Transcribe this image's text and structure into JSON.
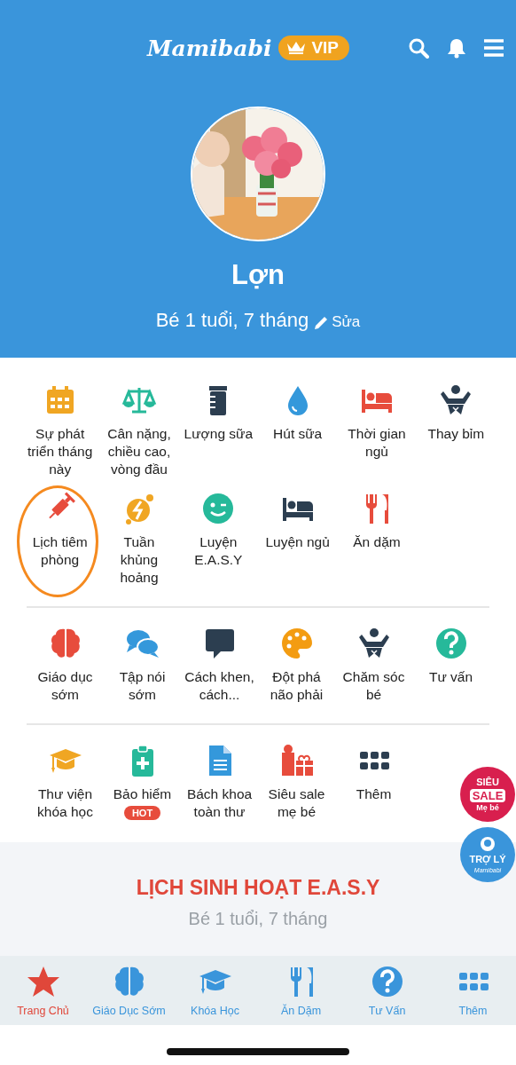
{
  "header": {
    "logo": "Mamibabi",
    "badge": "VIP"
  },
  "profile": {
    "name": "Lợn",
    "age": "Bé 1 tuổi, 7 tháng",
    "edit": "Sửa"
  },
  "menu_sections": [
    {
      "items": [
        {
          "label": "Sự phát triển tháng này",
          "circled": false
        },
        {
          "label": "Cân nặng, chiều cao, vòng đầu",
          "circled": false
        },
        {
          "label": "Lượng sữa",
          "circled": false
        },
        {
          "label": "Hút sữa",
          "circled": false
        },
        {
          "label": "Thời gian ngủ",
          "circled": false
        },
        {
          "label": "Thay bỉm",
          "circled": false
        },
        {
          "label": "Lịch tiêm phòng",
          "circled": true
        },
        {
          "label": "Tuần khủng hoảng",
          "circled": false
        },
        {
          "label": "Luyện E.A.S.Y",
          "circled": false
        },
        {
          "label": "Luyện ngủ",
          "circled": false
        },
        {
          "label": "Ăn dặm",
          "circled": false
        }
      ]
    },
    {
      "items": [
        {
          "label": "Giáo dục sớm",
          "circled": false
        },
        {
          "label": "Tập nói sớm",
          "circled": false
        },
        {
          "label": "Cách khen, cách...",
          "circled": false
        },
        {
          "label": "Đột phá não phải",
          "circled": false
        },
        {
          "label": "Chăm sóc bé",
          "circled": false
        },
        {
          "label": "Tư vấn",
          "circled": false
        }
      ]
    },
    {
      "items": [
        {
          "label": "Thư viện khóa học",
          "circled": false
        },
        {
          "label": "Bảo hiểm",
          "badge": "HOT",
          "circled": false
        },
        {
          "label": "Bách khoa toàn thư",
          "circled": false
        },
        {
          "label": "Siêu sale mẹ bé",
          "circled": false
        },
        {
          "label": "Thêm",
          "circled": false
        }
      ]
    }
  ],
  "floating_buttons": [
    {
      "kind": "sale",
      "top": "SIÊU",
      "main": "SALE",
      "bottom": "Mẹ bé"
    },
    {
      "kind": "assistant",
      "main": "TRỢ LÝ",
      "bottom": "Mamibabi"
    }
  ],
  "schedule": {
    "title": "LỊCH SINH HOẠT E.A.S.Y",
    "subtitle": "Bé 1 tuổi, 7 tháng"
  },
  "tabs": [
    {
      "label": "Trang Chủ",
      "selected": true
    },
    {
      "label": "Giáo Dục Sớm",
      "selected": false
    },
    {
      "label": "Khóa Học",
      "selected": false
    },
    {
      "label": "Ăn Dặm",
      "selected": false
    },
    {
      "label": "Tư Vấn",
      "selected": false
    },
    {
      "label": "Thêm",
      "selected": false
    }
  ]
}
